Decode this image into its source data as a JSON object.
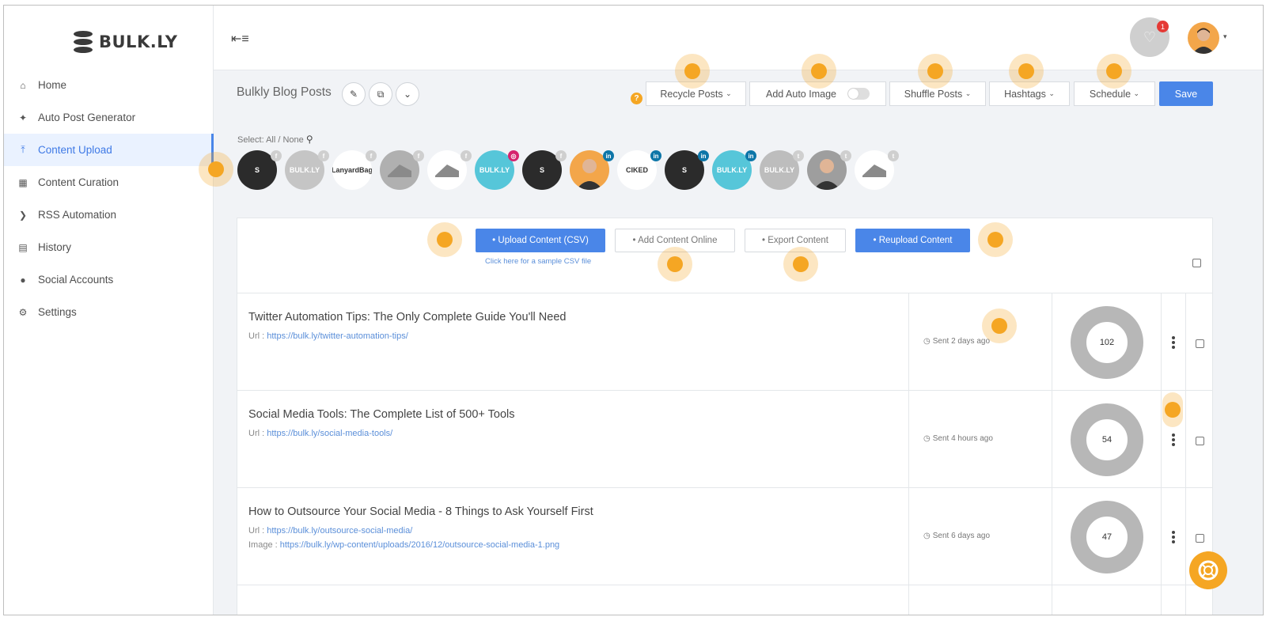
{
  "brand": {
    "name": "BULK.LY"
  },
  "sidebar": {
    "items": [
      {
        "label": "Home",
        "icon": "home-icon"
      },
      {
        "label": "Auto Post Generator",
        "icon": "magic-wand-icon"
      },
      {
        "label": "Content Upload",
        "icon": "upload-icon",
        "active": true
      },
      {
        "label": "Content Curation",
        "icon": "document-icon"
      },
      {
        "label": "RSS Automation",
        "icon": "rss-icon"
      },
      {
        "label": "History",
        "icon": "calendar-icon"
      },
      {
        "label": "Social Accounts",
        "icon": "user-icon"
      },
      {
        "label": "Settings",
        "icon": "gear-icon"
      }
    ]
  },
  "topbar": {
    "notification_count": "1"
  },
  "toolbar": {
    "title": "Bulkly Blog Posts",
    "recycle_label": "Recycle Posts",
    "auto_image_label": "Add Auto Image",
    "shuffle_label": "Shuffle Posts",
    "hashtags_label": "Hashtags",
    "schedule_label": "Schedule",
    "save_label": "Save",
    "help_glyph": "?"
  },
  "select": {
    "label": "Select: All / None"
  },
  "accounts": [
    {
      "label": "S",
      "network": "facebook"
    },
    {
      "label": "BULK.LY",
      "network": "facebook"
    },
    {
      "label": "LanyardBag",
      "network": "facebook"
    },
    {
      "label": "",
      "network": "facebook"
    },
    {
      "label": "",
      "network": "facebook"
    },
    {
      "label": "BULK.LY",
      "network": "instagram"
    },
    {
      "label": "S",
      "network": "facebook"
    },
    {
      "label": "",
      "network": "linkedin"
    },
    {
      "label": "CIKED",
      "network": "linkedin"
    },
    {
      "label": "S",
      "network": "linkedin"
    },
    {
      "label": "BULK.LY",
      "network": "linkedin"
    },
    {
      "label": "BULK.LY",
      "network": "twitter"
    },
    {
      "label": "",
      "network": "twitter"
    },
    {
      "label": "",
      "network": "twitter"
    }
  ],
  "content": {
    "upload_csv_label": "• Upload Content (CSV)",
    "add_online_label": "• Add Content Online",
    "export_label": "• Export Content",
    "reupload_label": "• Reupload Content",
    "sample_csv_link": "Click here for a sample CSV file"
  },
  "posts": [
    {
      "title": "Twitter Automation Tips: The Only Complete Guide You'll Need",
      "url_label": "Url :",
      "url": "https://bulk.ly/twitter-automation-tips/",
      "sent": "Sent 2 days ago",
      "count": "102",
      "count_fraction": 0.98
    },
    {
      "title": "Social Media Tools: The Complete List of 500+ Tools",
      "url_label": "Url :",
      "url": "https://bulk.ly/social-media-tools/",
      "sent": "Sent 4 hours ago",
      "count": "54",
      "count_fraction": 0.98
    },
    {
      "title": "How to Outsource Your Social Media - 8 Things to Ask Yourself First",
      "url_label": "Url :",
      "url": "https://bulk.ly/outsource-social-media/",
      "image_label": "Image :",
      "image": "https://bulk.ly/wp-content/uploads/2016/12/outsource-social-media-1.png",
      "sent": "Sent 6 days ago",
      "count": "47",
      "count_fraction": 0.98
    }
  ],
  "colors": {
    "accent": "#4a86e8",
    "highlight": "#f5a623",
    "donut": "#b7b7b7"
  }
}
